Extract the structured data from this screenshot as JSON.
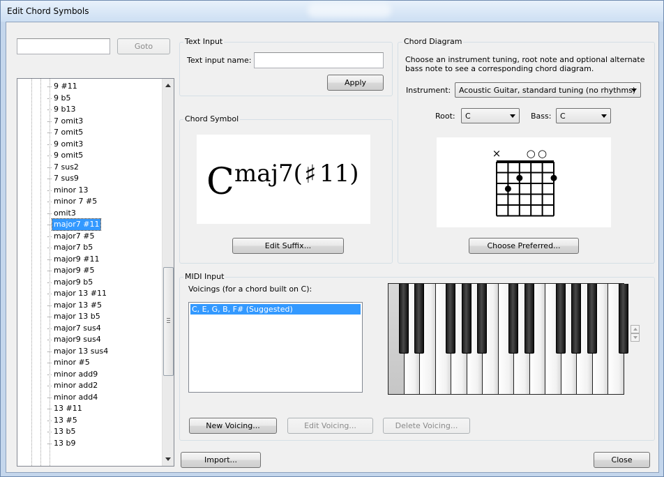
{
  "window": {
    "title": "Edit Chord Symbols"
  },
  "goto": {
    "value": "",
    "button_label": "Goto"
  },
  "tree": {
    "items": [
      "9 #11",
      "9 b5",
      "9 b13",
      "7 omit3",
      "7 omit5",
      "9 omit3",
      "9 omit5",
      "7 sus2",
      "7 sus9",
      "minor 13",
      "minor 7 #5",
      "omit3",
      "major7 #11",
      "major7 #5",
      "major7 b5",
      "major9 #11",
      "major9 #5",
      "major9 b5",
      "major 13 #11",
      "major 13 #5",
      "major 13 b5",
      "major7 sus4",
      "major9 sus4",
      "major 13 sus4",
      "minor #5",
      "minor add9",
      "minor add2",
      "minor add4",
      "13 #11",
      "13 #5",
      "13 b5",
      "13 b9"
    ],
    "selected_index": 12
  },
  "text_input": {
    "group_label": "Text Input",
    "name_label": "Text input name:",
    "name_value": "",
    "apply_label": "Apply"
  },
  "chord_symbol": {
    "group_label": "Chord Symbol",
    "root": "C",
    "suffix": "maj7(",
    "accidental": "♯",
    "tail": "11)",
    "edit_suffix_label": "Edit Suffix..."
  },
  "chord_diagram": {
    "group_label": "Chord Diagram",
    "description": "Choose an instrument tuning, root note and optional alternate bass note to see a corresponding chord diagram.",
    "instrument_label": "Instrument:",
    "instrument_value": "Acoustic Guitar, standard tuning (no rhythms)",
    "root_label": "Root:",
    "root_value": "C",
    "bass_label": "Bass:",
    "bass_value": "C",
    "string_markers": [
      "×",
      "",
      "",
      "○",
      "○",
      ""
    ],
    "dots": [
      {
        "string": 1,
        "fret": 3
      },
      {
        "string": 2,
        "fret": 2
      },
      {
        "string": 5,
        "fret": 2
      }
    ],
    "choose_preferred_label": "Choose Preferred..."
  },
  "midi_input": {
    "group_label": "MIDI Input",
    "voicings_label": "Voicings (for a chord built on C):",
    "voicings": [
      "C, E, G, B, F# (Suggested)"
    ],
    "pressed_white_keys": [
      0
    ],
    "new_voicing_label": "New Voicing...",
    "edit_voicing_label": "Edit Voicing...",
    "delete_voicing_label": "Delete Voicing..."
  },
  "footer": {
    "import_label": "Import...",
    "close_label": "Close"
  }
}
